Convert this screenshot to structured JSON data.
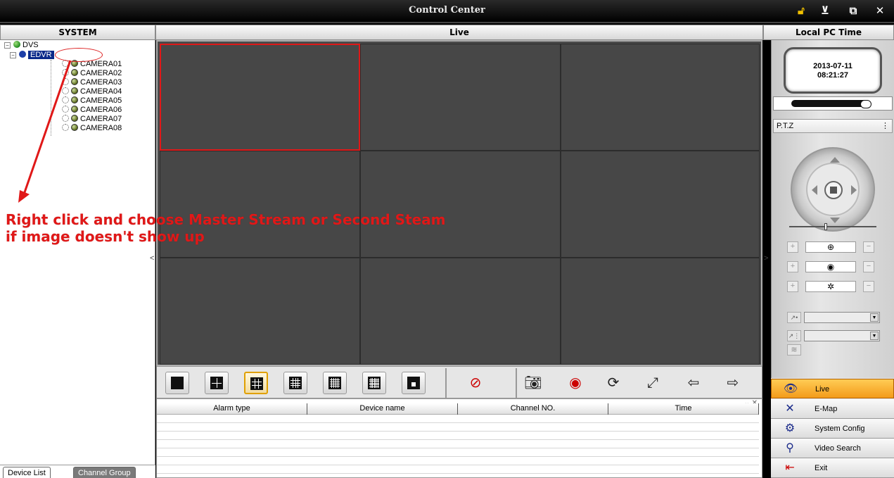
{
  "window": {
    "title": "Control Center",
    "buttons": [
      "lock-icon",
      "minimize-icon",
      "restore-icon",
      "close-icon"
    ]
  },
  "headers": {
    "left": "SYSTEM",
    "center": "Live",
    "right": "Local PC Time"
  },
  "tree": {
    "root": "DVS",
    "device": "EDVR",
    "cameras": [
      "CAMERA01",
      "CAMERA02",
      "CAMERA03",
      "CAMERA04",
      "CAMERA05",
      "CAMERA06",
      "CAMERA07",
      "CAMERA08"
    ]
  },
  "annotation": {
    "line1": "Right click and choose Master Stream or Second Steam",
    "line2": "if image doesn't show up",
    "color": "#e01818"
  },
  "left_tabs": [
    "Device List",
    "Channel Group"
  ],
  "layout_grid": {
    "rows": 3,
    "cols": 3,
    "selected_cell": 0,
    "selected_color": "#e01818"
  },
  "toolbar": {
    "layout_buttons": [
      "1-view",
      "4-view",
      "9-view",
      "16-view",
      "25-view",
      "36-view",
      "custom-view"
    ],
    "active_layout": "9-view",
    "icons": [
      "stop-record-icon",
      "snapshot-icon",
      "stop-preview-icon",
      "cycle-icon",
      "fullscreen-icon",
      "prev-page-icon",
      "next-page-icon"
    ]
  },
  "alarm_table": {
    "columns": [
      "Alarm type",
      "Device name",
      "Channel NO.",
      "Time"
    ],
    "rows": []
  },
  "clock": {
    "date": "2013-07-11",
    "time": "08:21:27"
  },
  "ptz": {
    "header": "P.T.Z",
    "rows": [
      {
        "name": "zoom",
        "icon": "⊕"
      },
      {
        "name": "focus",
        "icon": "◉"
      },
      {
        "name": "iris",
        "icon": "✲"
      }
    ]
  },
  "nav": [
    {
      "label": "Live",
      "icon": "live-icon",
      "active": true
    },
    {
      "label": "E-Map",
      "icon": "map-icon",
      "active": false
    },
    {
      "label": "System Config",
      "icon": "gear-icon",
      "active": false
    },
    {
      "label": "Video Search",
      "icon": "search-video-icon",
      "active": false
    },
    {
      "label": "Exit",
      "icon": "exit-icon",
      "active": false
    }
  ],
  "colors": {
    "accent_active_nav": "#f39b1a",
    "video_bg": "#474747"
  }
}
